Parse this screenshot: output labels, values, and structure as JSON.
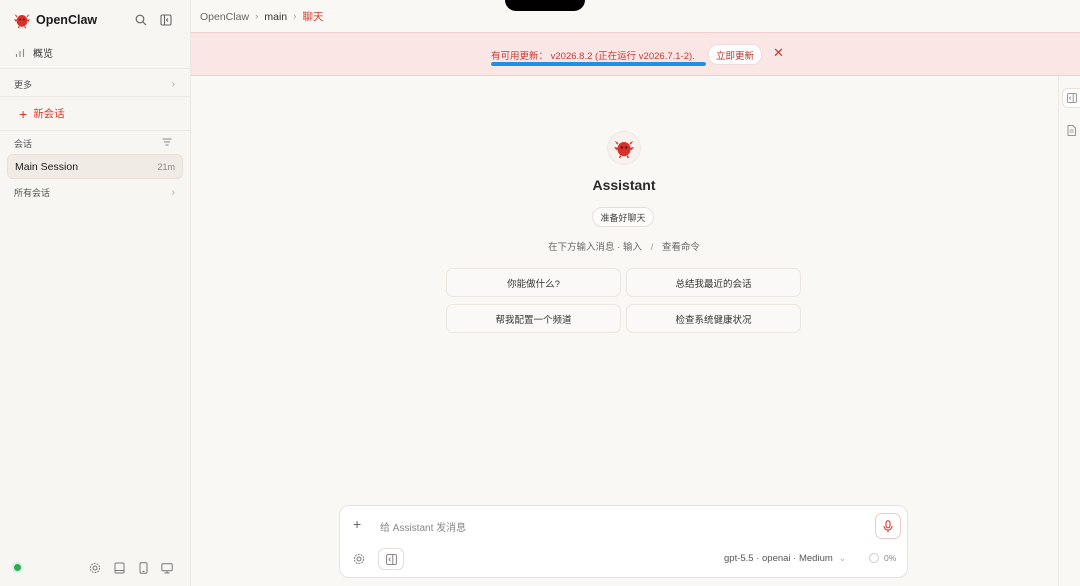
{
  "sidebar": {
    "brand": "OpenClaw",
    "overview_label": "概览",
    "more_label": "更多",
    "new_chat_label": "新会话",
    "sessions_heading": "会话",
    "sessions": [
      {
        "name": "Main Session",
        "time": "21m"
      }
    ],
    "all_sessions_label": "所有会话"
  },
  "header": {
    "breadcrumb": [
      "OpenClaw",
      "main",
      "聊天"
    ]
  },
  "banner": {
    "text": "有可用更新： v2026.8.2 (正在运行 v2026.7.1-2).",
    "button_label": "立即更新",
    "progress": 1.0
  },
  "main": {
    "title": "Assistant",
    "ready_label": "准备好聊天",
    "hint_left": "在下方输入消息 · 输入",
    "hint_slash": "/",
    "hint_right": "查看命令",
    "suggestions": [
      "你能做什么?",
      "总结我最近的会话",
      "帮我配置一个频道",
      "检查系统健康状况"
    ]
  },
  "composer": {
    "placeholder": "给 Assistant 发消息",
    "model_label": "gpt-5.5 · openai · Medium",
    "context_usage": "0%"
  },
  "colors": {
    "accent": "#d6352a",
    "banner_bg": "#fbe6e6",
    "progress": "#1e90e8",
    "status_ok": "#2eaa55"
  }
}
